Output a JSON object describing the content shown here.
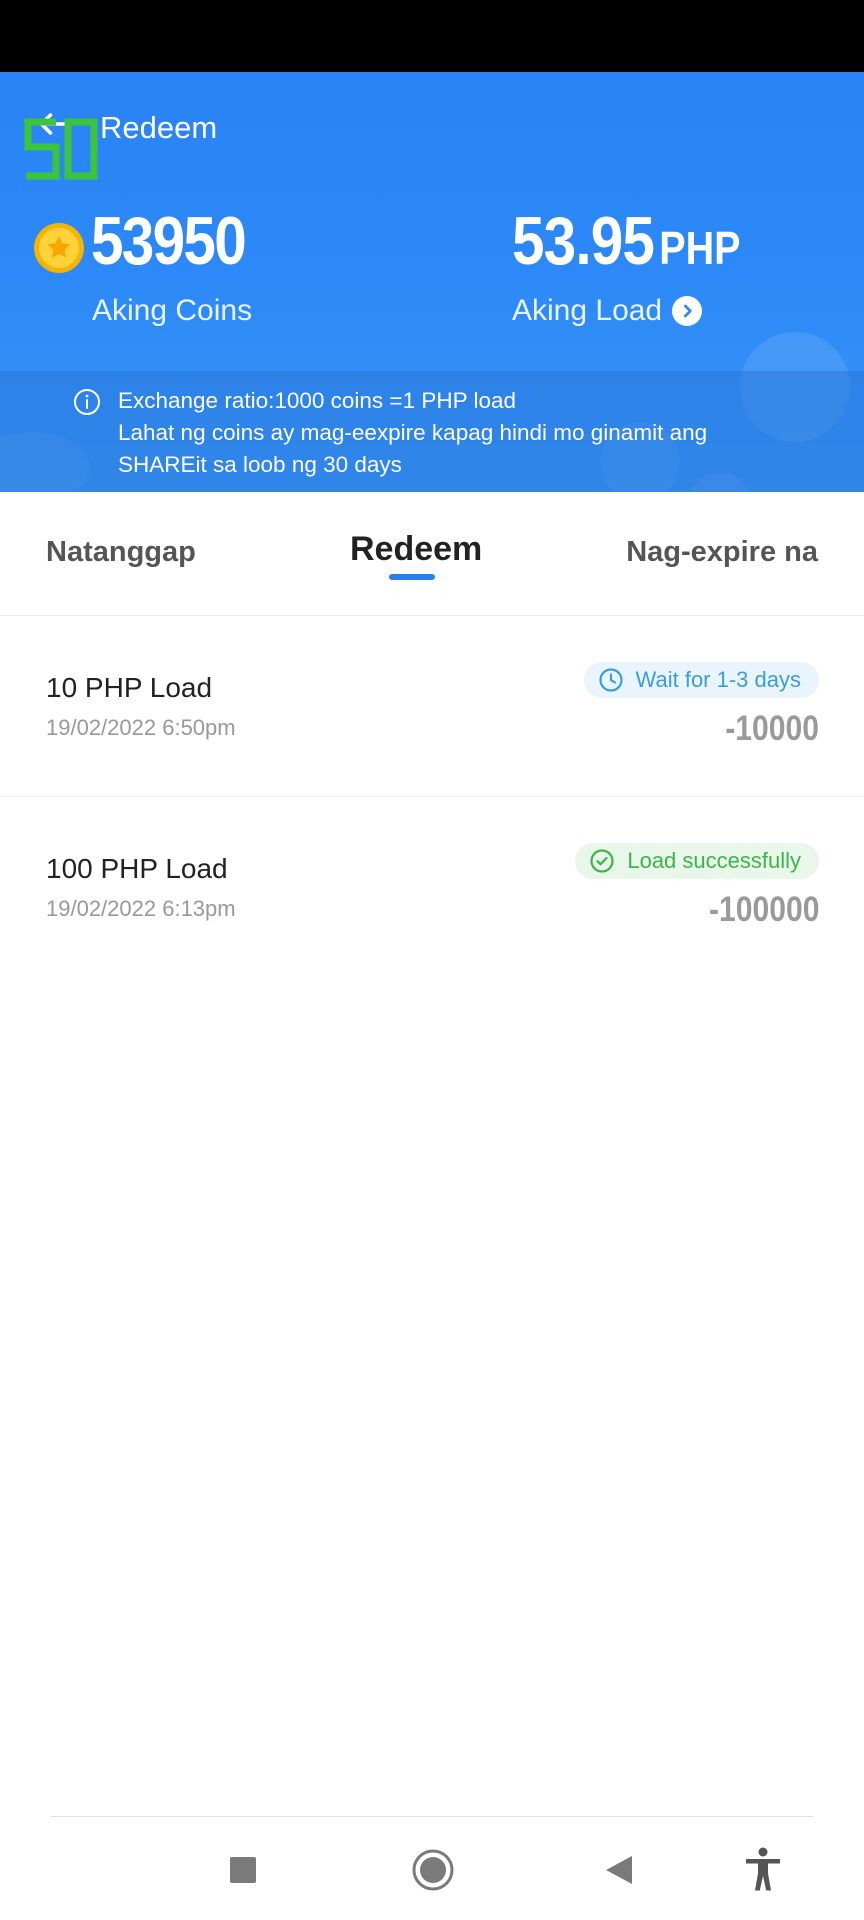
{
  "header": {
    "title": "Redeem",
    "coins": {
      "value": "53950",
      "label": "Aking Coins"
    },
    "load": {
      "value": "53.95",
      "unit": "PHP",
      "label": "Aking Load"
    },
    "info": {
      "line1": "Exchange ratio:1000 coins =1 PHP load",
      "line2": "Lahat ng coins ay mag-eexpire kapag hindi mo ginamit ang",
      "line3": "SHAREit sa loob ng 30 days"
    }
  },
  "tabs": [
    {
      "label": "Natanggap",
      "active": false
    },
    {
      "label": "Redeem",
      "active": true
    },
    {
      "label": "Nag-expire na",
      "active": false
    }
  ],
  "transactions": [
    {
      "title": "10 PHP Load",
      "date": "19/02/2022 6:50pm",
      "status": "Wait for 1-3 days",
      "status_icon": "clock-icon",
      "amount": "-10000"
    },
    {
      "title": "100 PHP Load",
      "date": "19/02/2022 6:13pm",
      "status": "Load successfully",
      "status_icon": "check-circle-icon",
      "amount": "-100000"
    }
  ],
  "colors": {
    "header_blue": "#2d8af7",
    "tab_accent": "#2a7ff0",
    "wait": "#3b9ed6",
    "success": "#3cb54a"
  }
}
